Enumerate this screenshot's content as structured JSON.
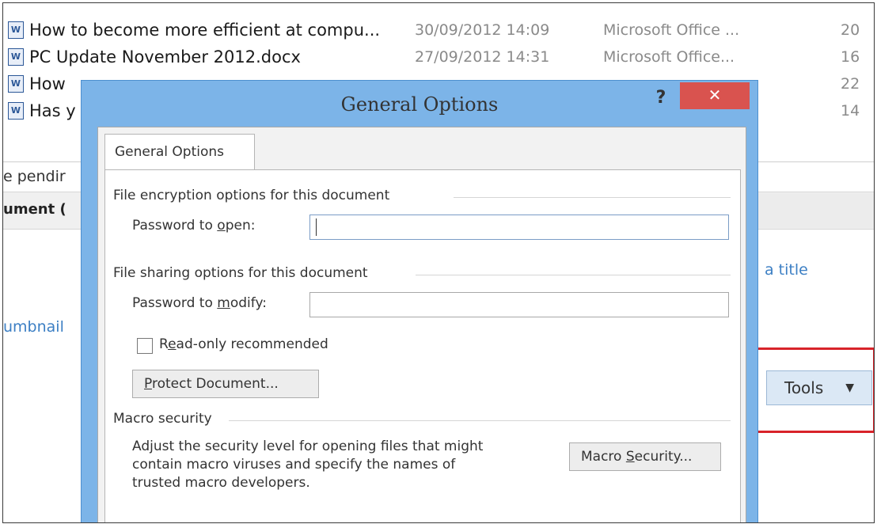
{
  "files": [
    {
      "name": "How to become more efficient at compu...",
      "date": "30/09/2012 14:09",
      "type": "Microsoft Office ...",
      "size": "20"
    },
    {
      "name": "PC Update November 2012.docx",
      "date": "27/09/2012 14:31",
      "type": "Microsoft Office...",
      "size": "16"
    },
    {
      "name": "How",
      "date": "",
      "type": "",
      "size": "22"
    },
    {
      "name": "Has y",
      "date": "",
      "type": "",
      "size": "14"
    }
  ],
  "background": {
    "pending_text": "e pendir",
    "document_text": "ument (",
    "thumbnail_text": "umbnail",
    "title_link": "a title",
    "tools_label": "Tools",
    "tools_arrow": "▼"
  },
  "dialog": {
    "title": "General Options",
    "help_label": "?",
    "close_label": "✕",
    "tab_label": "General Options",
    "encryption_group": "File encryption options for this document",
    "password_open_label": "Password to open:",
    "password_open_value": "",
    "sharing_group": "File sharing options for this document",
    "password_modify_label": "Password to modify:",
    "password_modify_value": "",
    "readonly_label": "Read-only recommended",
    "protect_button": "Protect Document...",
    "macro_group": "Macro security",
    "macro_text_1": "Adjust the security level for opening files that might",
    "macro_text_2": "contain macro viruses and specify the names of",
    "macro_text_3": "trusted macro developers.",
    "macro_button": "Macro Security..."
  },
  "colors": {
    "dialog_frame": "#7cb4e8",
    "close_button": "#d9534f",
    "highlight": "#d8232a"
  }
}
